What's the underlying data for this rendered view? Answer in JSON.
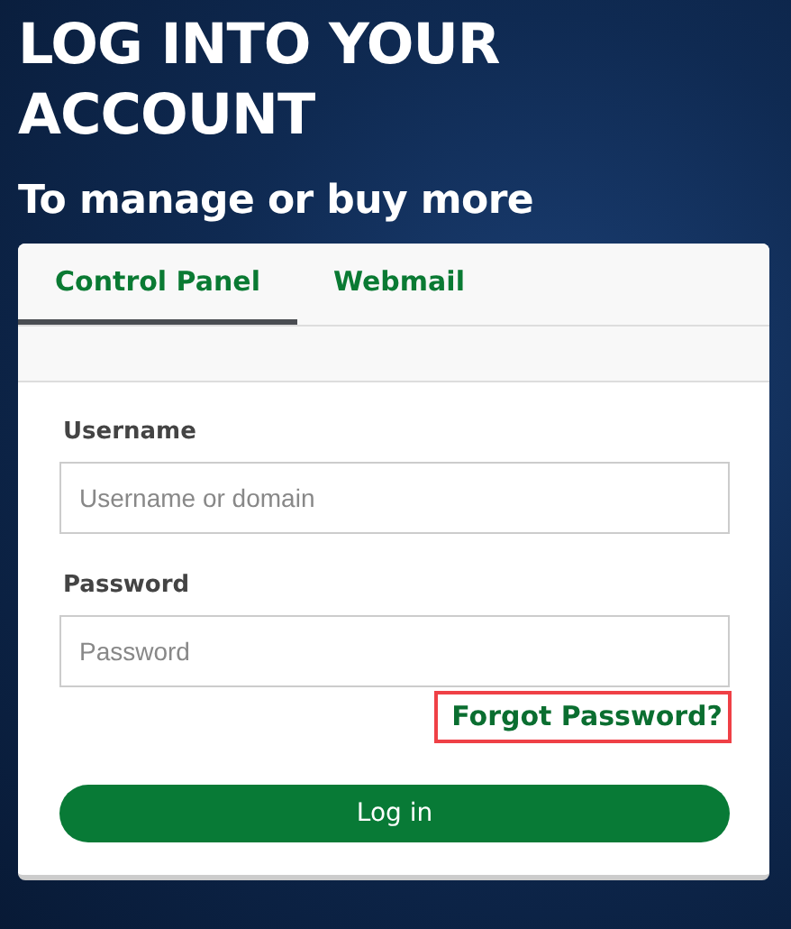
{
  "heading": "LOG INTO YOUR ACCOUNT",
  "subheading": "To manage or buy more",
  "tabs": [
    {
      "label": "Control Panel",
      "selected": true
    },
    {
      "label": "Webmail",
      "selected": false
    }
  ],
  "fields": [
    {
      "label": "Username",
      "placeholder": "Username or domain"
    },
    {
      "label": "Password",
      "placeholder": "Password"
    }
  ],
  "forgot_link": {
    "label": "Forgot Password?",
    "highlighted": true
  },
  "login_button": "Log in"
}
